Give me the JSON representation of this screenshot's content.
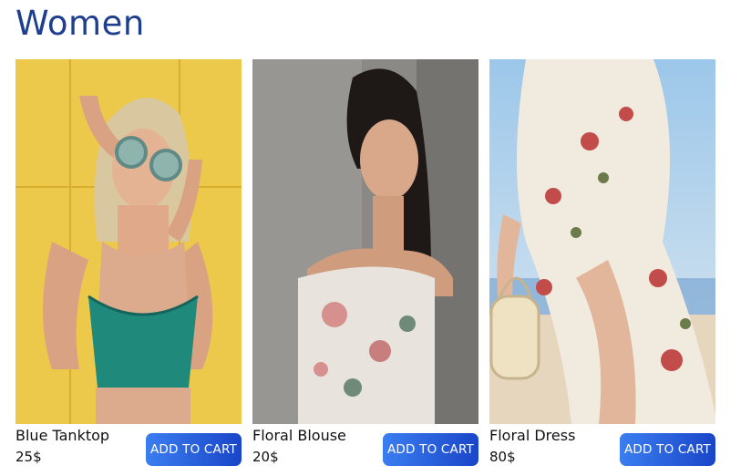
{
  "section": {
    "title": "Women"
  },
  "products": [
    {
      "name": "Blue Tanktop",
      "price": "25$",
      "cta": "ADD TO CART",
      "image": "woman-yellow-wall-sunglasses-green-top"
    },
    {
      "name": "Floral Blouse",
      "price": "20$",
      "cta": "ADD TO CART",
      "image": "woman-dark-hair-floral-off-shoulder-blouse"
    },
    {
      "name": "Floral Dress",
      "price": "80$",
      "cta": "ADD TO CART",
      "image": "woman-floral-wrap-dress-beach"
    }
  ],
  "colors": {
    "title": "#1e3f8f",
    "button_start": "#3a7ef0",
    "button_end": "#1a45c9"
  }
}
